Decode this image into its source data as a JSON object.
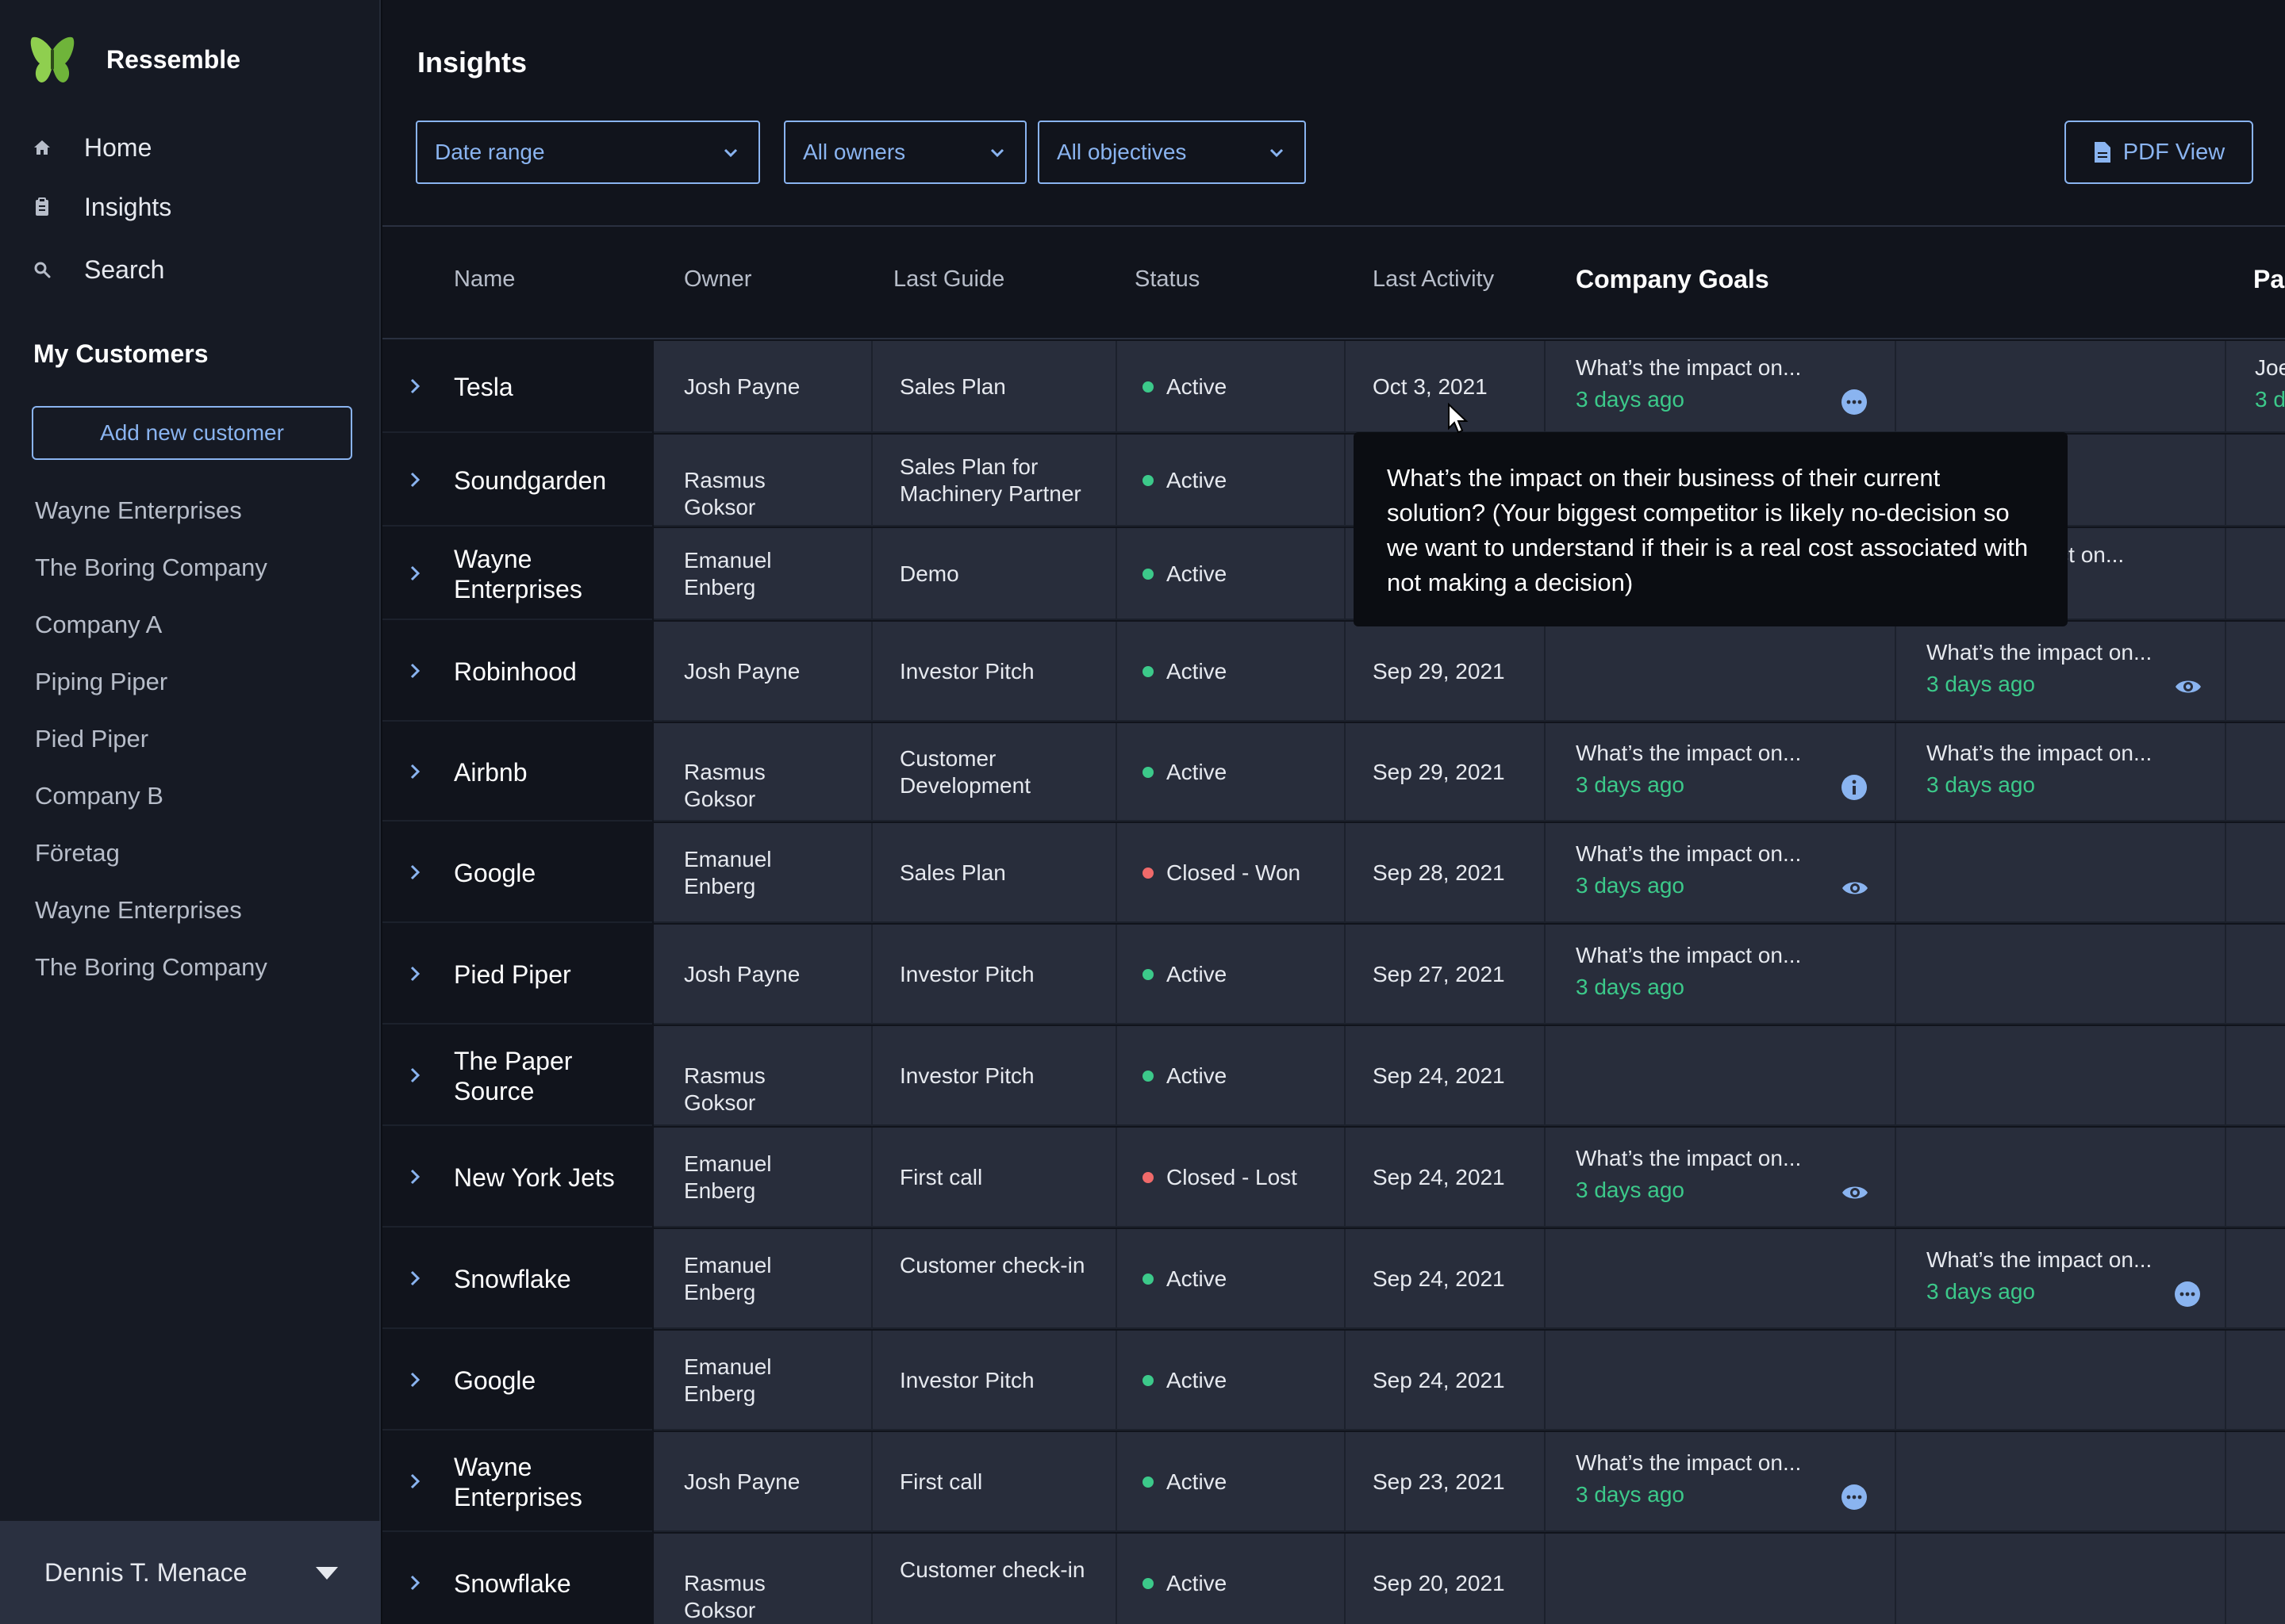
{
  "app": {
    "brand": "Ressemble",
    "page_title": "Insights"
  },
  "sidebar": {
    "nav": [
      {
        "label": "Home",
        "icon": "home-icon"
      },
      {
        "label": "Insights",
        "icon": "clipboard-icon"
      },
      {
        "label": "Search",
        "icon": "search-icon"
      }
    ],
    "section_title": "My Customers",
    "add_button": "Add new customer",
    "customers": [
      "Wayne Enterprises",
      "The Boring Company",
      "Company A",
      "Piping Piper",
      "Pied Piper",
      "Company B",
      "Företag",
      "Wayne Enterprises",
      "The Boring Company"
    ],
    "user": "Dennis T. Menace"
  },
  "filters": {
    "date_range": "Date range",
    "owners": "All owners",
    "objectives": "All objectives",
    "pdf_view": "PDF View"
  },
  "table": {
    "headers": {
      "name": "Name",
      "owner": "Owner",
      "last_guide": "Last Guide",
      "status": "Status",
      "last_activity": "Last Activity",
      "company_goals": "Company Goals",
      "partial": "Pa"
    },
    "rows": [
      {
        "name": "Tesla",
        "owner": "Josh Payne",
        "guide": "Sales Plan",
        "status": "Active",
        "date": "Oct 3, 2021",
        "g1": {
          "q": "What’s the impact on...",
          "t": "3 days ago",
          "icon": "more-icon"
        },
        "p": {
          "q": "Joe",
          "t": "3 d"
        }
      },
      {
        "name": "Soundgarden",
        "owner": "Rasmus Goksor",
        "guide": "Sales Plan for Machinery Partner",
        "status": "Active",
        "date": ""
      },
      {
        "name": "Wayne Enterprises",
        "owner": "Emanuel Enberg",
        "guide": "Demo",
        "status": "Active",
        "date": "",
        "g2": {
          "q": "pact on...",
          "t": ""
        }
      },
      {
        "name": "Robinhood",
        "owner": "Josh Payne",
        "guide": "Investor Pitch",
        "status": "Active",
        "date": "Sep 29, 2021",
        "g2": {
          "q": "What’s the impact on...",
          "t": "3 days ago",
          "icon": "eye-icon"
        }
      },
      {
        "name": "Airbnb",
        "owner": "Rasmus Goksor",
        "guide": "Customer Development",
        "status": "Active",
        "date": "Sep 29, 2021",
        "g1": {
          "q": "What’s the impact on...",
          "t": "3 days ago",
          "icon": "info-icon"
        },
        "g2": {
          "q": "What’s the impact on...",
          "t": "3 days ago"
        }
      },
      {
        "name": "Google",
        "owner": "Emanuel Enberg",
        "guide": "Sales Plan",
        "status": "Closed - Won",
        "date": "Sep 28, 2021",
        "g1": {
          "q": "What’s the impact on...",
          "t": "3 days ago",
          "icon": "eye-icon"
        }
      },
      {
        "name": "Pied Piper",
        "owner": "Josh Payne",
        "guide": "Investor Pitch",
        "status": "Active",
        "date": "Sep 27, 2021",
        "g1": {
          "q": "What’s the impact on...",
          "t": "3 days ago"
        }
      },
      {
        "name": "The Paper Source",
        "owner": "Rasmus Goksor",
        "guide": "Investor Pitch",
        "status": "Active",
        "date": "Sep 24, 2021"
      },
      {
        "name": "New York Jets",
        "owner": "Emanuel Enberg",
        "guide": "First call",
        "status": "Closed - Lost",
        "date": "Sep 24, 2021",
        "g1": {
          "q": "What’s the impact on...",
          "t": "3 days ago",
          "icon": "eye-icon"
        }
      },
      {
        "name": "Snowflake",
        "owner": "Emanuel Enberg",
        "guide": "Customer check-in",
        "status": "Active",
        "date": "Sep 24, 2021",
        "g2": {
          "q": "What’s the impact on...",
          "t": "3 days ago",
          "icon": "more-icon"
        }
      },
      {
        "name": "Google",
        "owner": "Emanuel Enberg",
        "guide": "Investor Pitch",
        "status": "Active",
        "date": "Sep 24, 2021"
      },
      {
        "name": "Wayne Enterprises",
        "owner": "Josh Payne",
        "guide": "First call",
        "status": "Active",
        "date": "Sep 23, 2021",
        "g1": {
          "q": "What’s the impact on...",
          "t": "3 days ago",
          "icon": "more-icon"
        }
      },
      {
        "name": "Snowflake",
        "owner": "Rasmus Goksor",
        "guide": "Customer check-in",
        "status": "Active",
        "date": "Sep 20, 2021"
      }
    ]
  },
  "tooltip": {
    "text": "What’s the impact on their business of their current solution? (Your biggest competitor is likely no-decision so we want to understand if their is a real cost associated with not making a decision)"
  },
  "colors": {
    "accent": "#8ab4f0",
    "active": "#3cc98a",
    "closed": "#f06a6a",
    "time": "#3cc98a"
  }
}
